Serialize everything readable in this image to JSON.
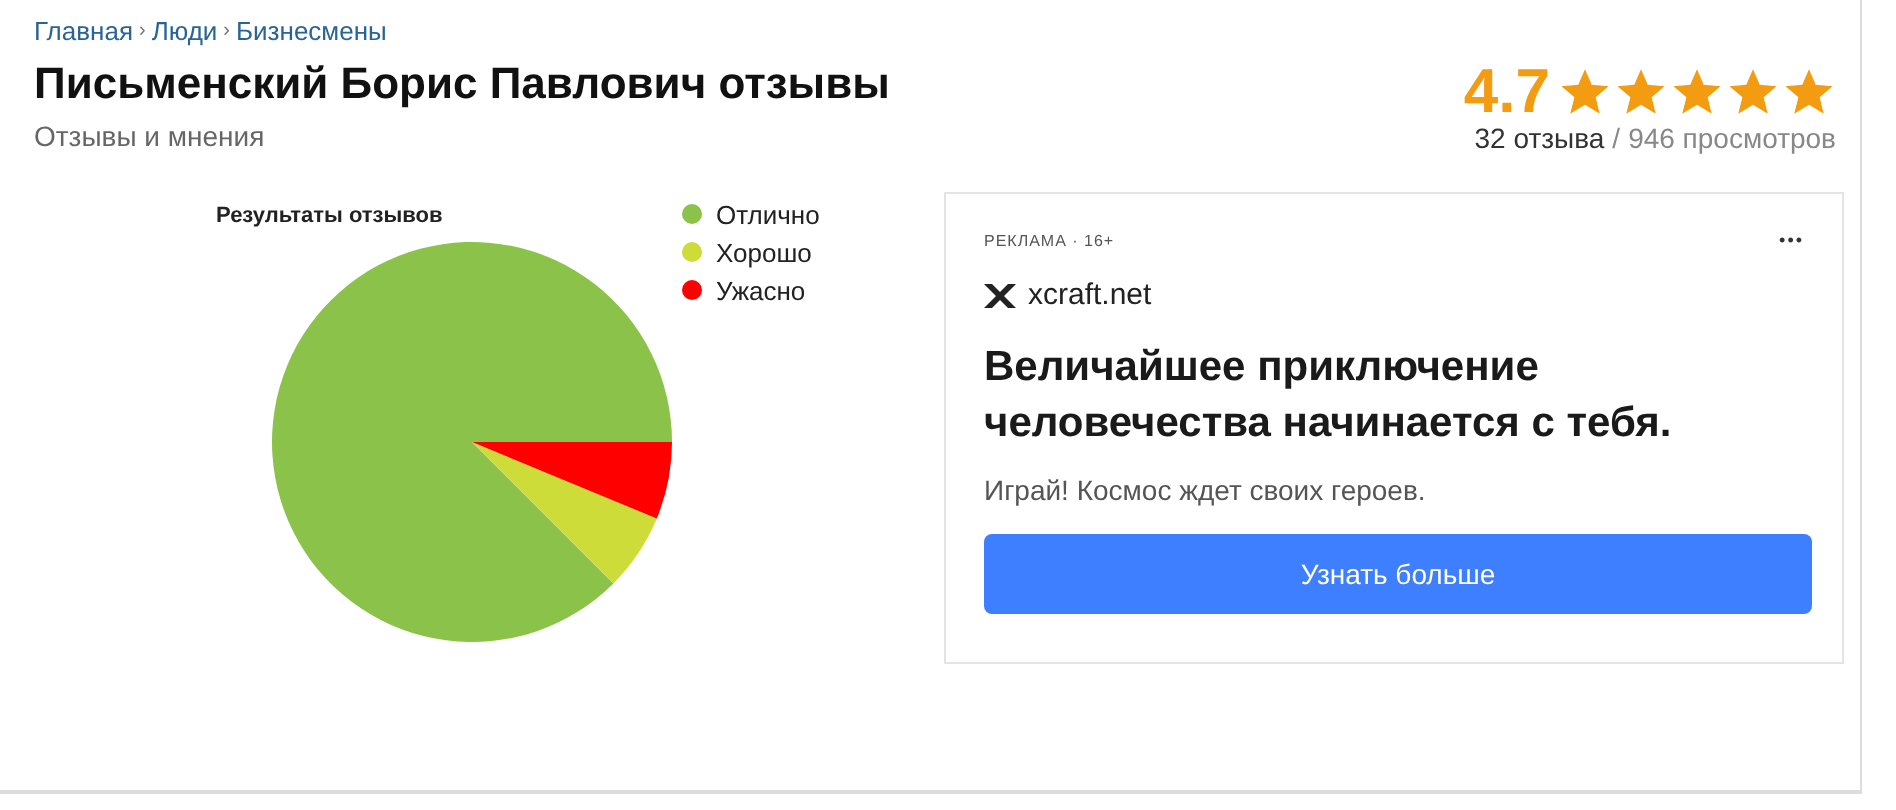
{
  "breadcrumbs": [
    "Главная",
    "Люди",
    "Бизнесмены"
  ],
  "separator": "›",
  "title": "Письменский Борис Павлович отзывы",
  "subtitle": "Отзывы и мнения",
  "rating": {
    "value": "4.7",
    "stars": 5,
    "reviews": "32 отзыва",
    "separator": "/",
    "views": "946 просмотров"
  },
  "chart": {
    "chart_data": {
      "type": "pie",
      "title": "Результаты отзывов",
      "legend": "right",
      "categories": [
        "Отлично",
        "Хорошо",
        "Ужасно"
      ],
      "colors": [
        "#8bc34a",
        "#cddc39",
        "#ff0000"
      ],
      "values": [
        87.5,
        6.25,
        6.25
      ]
    }
  },
  "ad": {
    "label": "РЕКЛАМА · 16+",
    "menu": "•••",
    "domain": "xcraft.net",
    "headline": "Величайшее приключение человечества начинается с тебя.",
    "text": "Играй! Космос ждет своих героев.",
    "button": "Узнать больше"
  }
}
